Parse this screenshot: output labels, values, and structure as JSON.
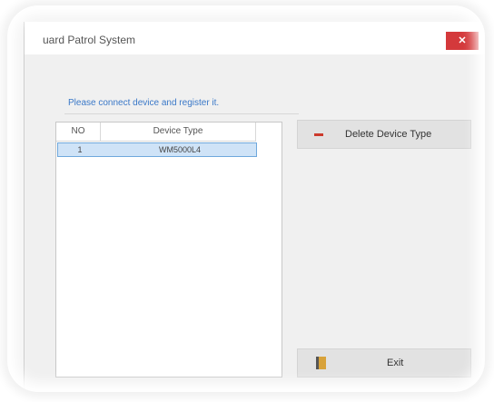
{
  "window": {
    "title": "uard Patrol System",
    "close_glyph": "✕"
  },
  "main": {
    "hint": "Please connect device and register it."
  },
  "device_list": {
    "columns": [
      "NO",
      "Device Type"
    ],
    "rows": [
      {
        "no": "1",
        "type": "WM5000L4"
      }
    ],
    "selected_row": 0
  },
  "buttons": {
    "delete_label": "Delete Device Type",
    "delete_icon": "minus-icon",
    "exit_label": "Exit",
    "exit_icon": "exit-door-icon"
  },
  "colors": {
    "close_button": "#d4393b",
    "hint_text": "#3a78c8",
    "selection": "#cfe3f7",
    "minus_icon": "#cc3a2c"
  }
}
